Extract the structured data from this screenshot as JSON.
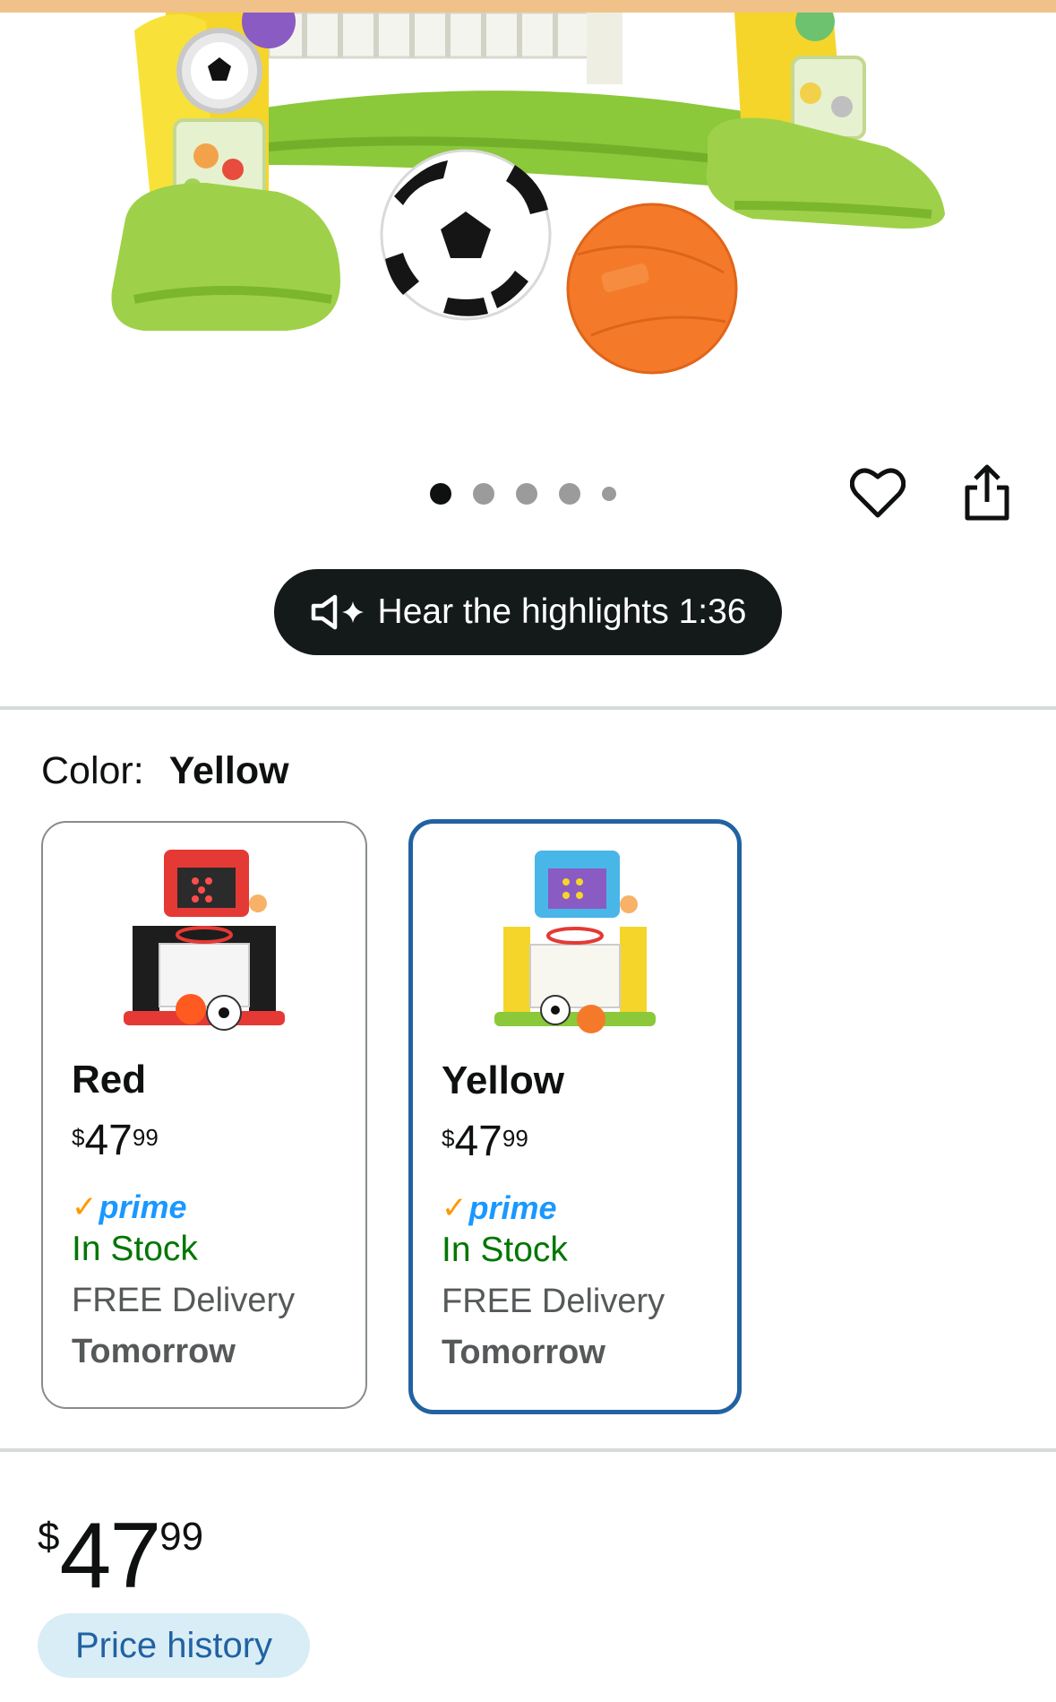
{
  "carousel": {
    "dot_count": 5,
    "active_index": 0,
    "favorite_icon": "heart-icon",
    "share_icon": "share-icon"
  },
  "highlights": {
    "label": "Hear the highlights 1:36",
    "icon": "speaker-sparkle-icon"
  },
  "color": {
    "label": "Color:",
    "selected": "Yellow"
  },
  "variants": [
    {
      "name": "Red",
      "price_currency": "$",
      "price_whole": "47",
      "price_fraction": "99",
      "prime_check": "✓",
      "prime_label": "prime",
      "stock": "In Stock",
      "delivery": "FREE Delivery",
      "delivery_day": "Tomorrow",
      "selected": false
    },
    {
      "name": "Yellow",
      "price_currency": "$",
      "price_whole": "47",
      "price_fraction": "99",
      "prime_check": "✓",
      "prime_label": "prime",
      "stock": "In Stock",
      "delivery": "FREE Delivery",
      "delivery_day": "Tomorrow",
      "selected": true
    }
  ],
  "price": {
    "currency": "$",
    "whole": "47",
    "fraction": "99"
  },
  "price_history": {
    "label": "Price history"
  },
  "colors": {
    "accent_blue": "#2162a1",
    "prime_blue": "#1a98ff",
    "in_stock_green": "#007600",
    "prime_check_orange": "#ff9900",
    "pill_dark": "#141a1a",
    "price_history_bg": "#d9edf7"
  }
}
